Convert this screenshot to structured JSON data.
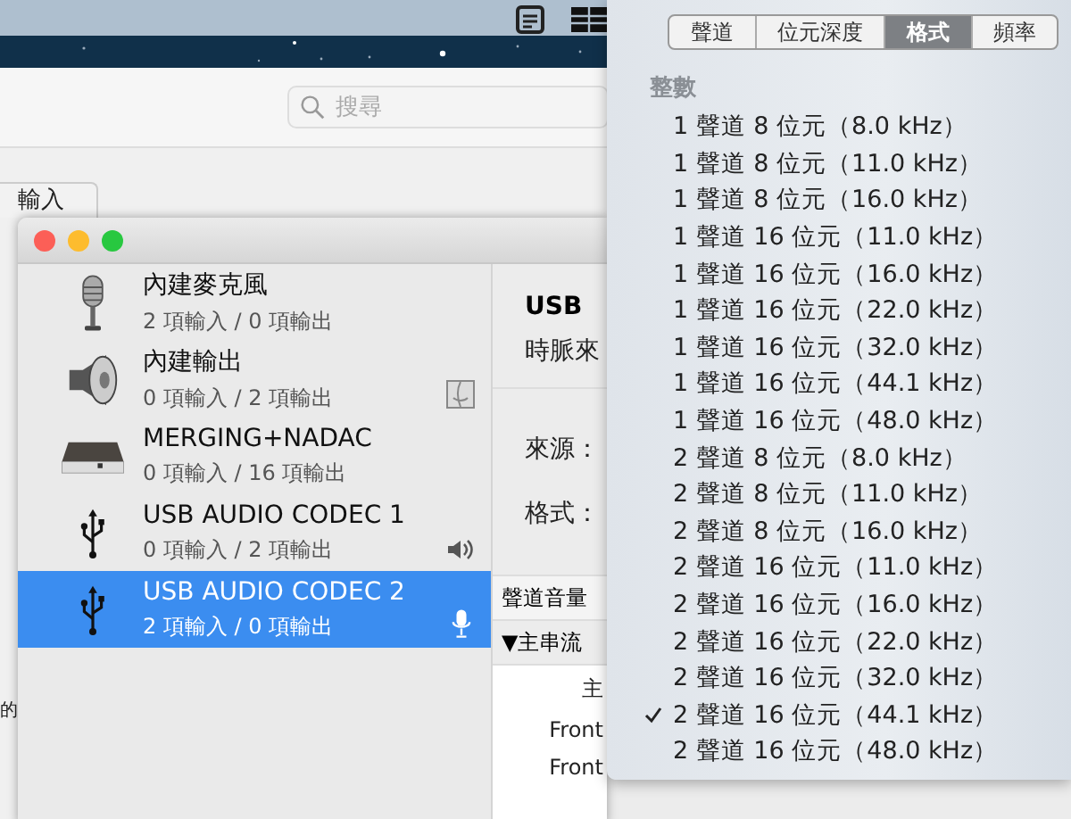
{
  "background_window": {
    "search": {
      "placeholder": "搜尋"
    },
    "tab": {
      "label": "輸入",
      "selected": true
    },
    "side_text": "的"
  },
  "devices_window": {
    "devices": [
      {
        "name": "內建麥克風",
        "io": "2 項輸入 / 0 項輸出",
        "kind": "mic",
        "selected": false
      },
      {
        "name": "內建輸出",
        "io": "0 項輸入 / 2 項輸出",
        "kind": "speaker",
        "badge": {
          "kind": "finder"
        },
        "selected": false
      },
      {
        "name": "MERGING+NADAC",
        "io": "0 項輸入 / 16 項輸出",
        "kind": "box",
        "selected": false
      },
      {
        "name": "USB AUDIO  CODEC 1",
        "io": "0 項輸入 / 2 項輸出",
        "kind": "usb",
        "badge": {
          "kind": "output"
        },
        "selected": false
      },
      {
        "name": "USB AUDIO  CODEC 2",
        "io": "2 項輸入 / 0 項輸出",
        "kind": "usb",
        "badge": {
          "kind": "input"
        },
        "selected": true
      }
    ],
    "detail": {
      "title": "USB",
      "clock": "時脈來",
      "source": "來源：",
      "format": "格式：",
      "volume_header": "聲道音量",
      "stream": "▼主串流",
      "rows": [
        "主",
        "Front",
        "Front"
      ]
    }
  },
  "format_menu": {
    "tabs": [
      {
        "label": "聲道",
        "selected": false
      },
      {
        "label": "位元深度",
        "selected": false
      },
      {
        "label": "格式",
        "selected": true
      },
      {
        "label": "頻率",
        "selected": false
      }
    ],
    "section": "整數",
    "items": [
      {
        "label": "1 聲道 8 位元（8.0 kHz）",
        "checked": false
      },
      {
        "label": "1 聲道 8 位元（11.0 kHz）",
        "checked": false
      },
      {
        "label": "1 聲道 8 位元（16.0 kHz）",
        "checked": false
      },
      {
        "label": "1 聲道 16 位元（11.0 kHz）",
        "checked": false
      },
      {
        "label": "1 聲道 16 位元（16.0 kHz）",
        "checked": false
      },
      {
        "label": "1 聲道 16 位元（22.0 kHz）",
        "checked": false
      },
      {
        "label": "1 聲道 16 位元（32.0 kHz）",
        "checked": false
      },
      {
        "label": "1 聲道 16 位元（44.1 kHz）",
        "checked": false
      },
      {
        "label": "1 聲道 16 位元（48.0 kHz）",
        "checked": false
      },
      {
        "label": "2 聲道 8 位元（8.0 kHz）",
        "checked": false
      },
      {
        "label": "2 聲道 8 位元（11.0 kHz）",
        "checked": false
      },
      {
        "label": "2 聲道 8 位元（16.0 kHz）",
        "checked": false
      },
      {
        "label": "2 聲道 16 位元（11.0 kHz）",
        "checked": false
      },
      {
        "label": "2 聲道 16 位元（16.0 kHz）",
        "checked": false
      },
      {
        "label": "2 聲道 16 位元（22.0 kHz）",
        "checked": false
      },
      {
        "label": "2 聲道 16 位元（32.0 kHz）",
        "checked": false
      },
      {
        "label": "2 聲道 16 位元（44.1 kHz）",
        "checked": true
      },
      {
        "label": "2 聲道 16 位元（48.0 kHz）",
        "checked": false
      }
    ]
  }
}
